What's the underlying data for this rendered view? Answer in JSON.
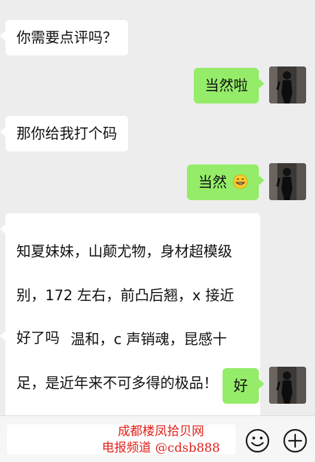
{
  "messages": [
    {
      "side": "left",
      "text": "你需要点评吗？"
    },
    {
      "side": "right",
      "text": "当然啦"
    },
    {
      "side": "left",
      "text": "那你给我打个码"
    },
    {
      "side": "right",
      "text": "当然",
      "emoji": "grinning-face"
    },
    {
      "side": "left",
      "lines": [
        "知夏妹妹，山颠尤物，身材超模级",
        "别，172 左右，前凸后翘，x 接近",
        "D，性格温和，c 声销魂，昆感十",
        "足，是近年来不可多得的极品！"
      ]
    },
    {
      "side": "left",
      "text": "好了吗"
    },
    {
      "side": "right",
      "text": "好"
    }
  ],
  "watermark": {
    "line1": "成都楼凤拾贝网",
    "line2": "电报频道 @cdsb888"
  },
  "input_bar": {
    "emoji_button": "smiley-face-icon",
    "more_button": "plus-icon"
  },
  "colors": {
    "chat_bg": "#ededed",
    "incoming_bubble": "#ffffff",
    "outgoing_bubble": "#95ec69",
    "watermark": "#e0211b"
  }
}
